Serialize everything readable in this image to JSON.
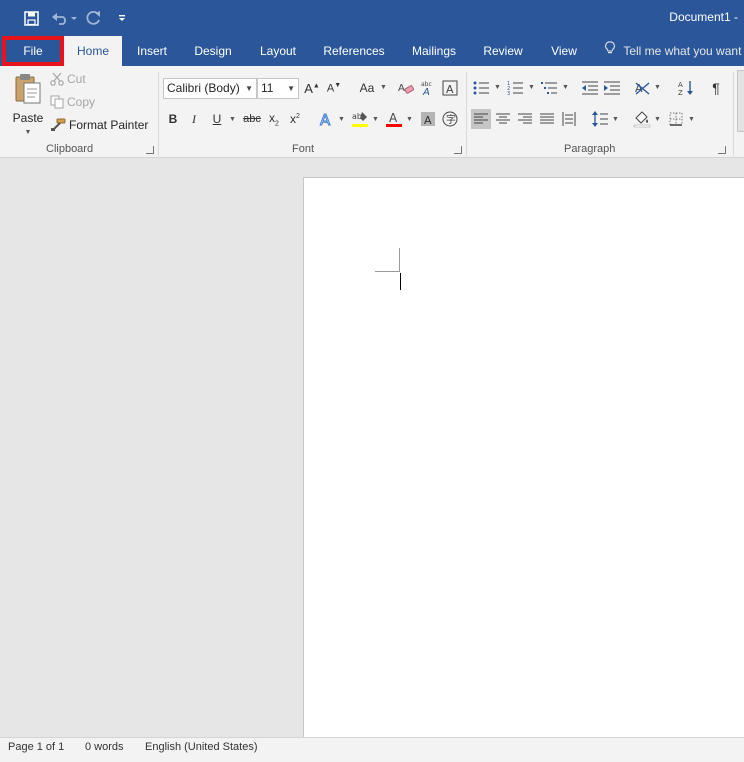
{
  "window": {
    "title": "Document1  -"
  },
  "quick_access": [
    {
      "name": "save-icon"
    },
    {
      "name": "undo-icon"
    },
    {
      "name": "redo-icon"
    },
    {
      "name": "customize-qat-icon"
    }
  ],
  "tabs": {
    "file": "File",
    "home": "Home",
    "insert": "Insert",
    "design": "Design",
    "layout": "Layout",
    "references": "References",
    "mailings": "Mailings",
    "review": "Review",
    "view": "View",
    "tell_me": "Tell me what you want"
  },
  "ribbon": {
    "clipboard": {
      "label": "Clipboard",
      "paste": "Paste",
      "cut": "Cut",
      "copy": "Copy",
      "format_painter": "Format Painter"
    },
    "font": {
      "label": "Font",
      "font_name": "Calibri (Body)",
      "font_size": "11"
    },
    "paragraph": {
      "label": "Paragraph"
    }
  },
  "colors": {
    "accent": "#2b579a",
    "highlight_marker": "#e8141d",
    "text_highlight": "#ffff00",
    "font_color": "#ff0000"
  },
  "status": {
    "page": "Page 1 of 1",
    "words": "0 words",
    "language": "English (United States)"
  }
}
